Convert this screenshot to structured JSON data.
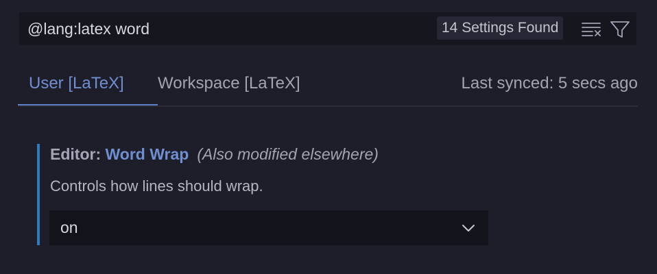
{
  "search": {
    "value": "@lang:latex word",
    "results_count": "14 Settings Found",
    "clear_icon": "clear-filter-icon",
    "filter_icon": "filter-icon"
  },
  "tabs": [
    {
      "label": "User [LaTeX]",
      "active": true
    },
    {
      "label": "Workspace [LaTeX]",
      "active": false
    }
  ],
  "sync_status": "Last synced: 5 secs ago",
  "setting": {
    "category": "Editor: ",
    "name": "Word Wrap",
    "note": "(Also modified elsewhere)",
    "description": "Controls how lines should wrap.",
    "value": "on"
  },
  "colors": {
    "background": "#1e1e2a",
    "accent": "#6f8fd0",
    "modified_indicator": "#2f7ab8"
  }
}
